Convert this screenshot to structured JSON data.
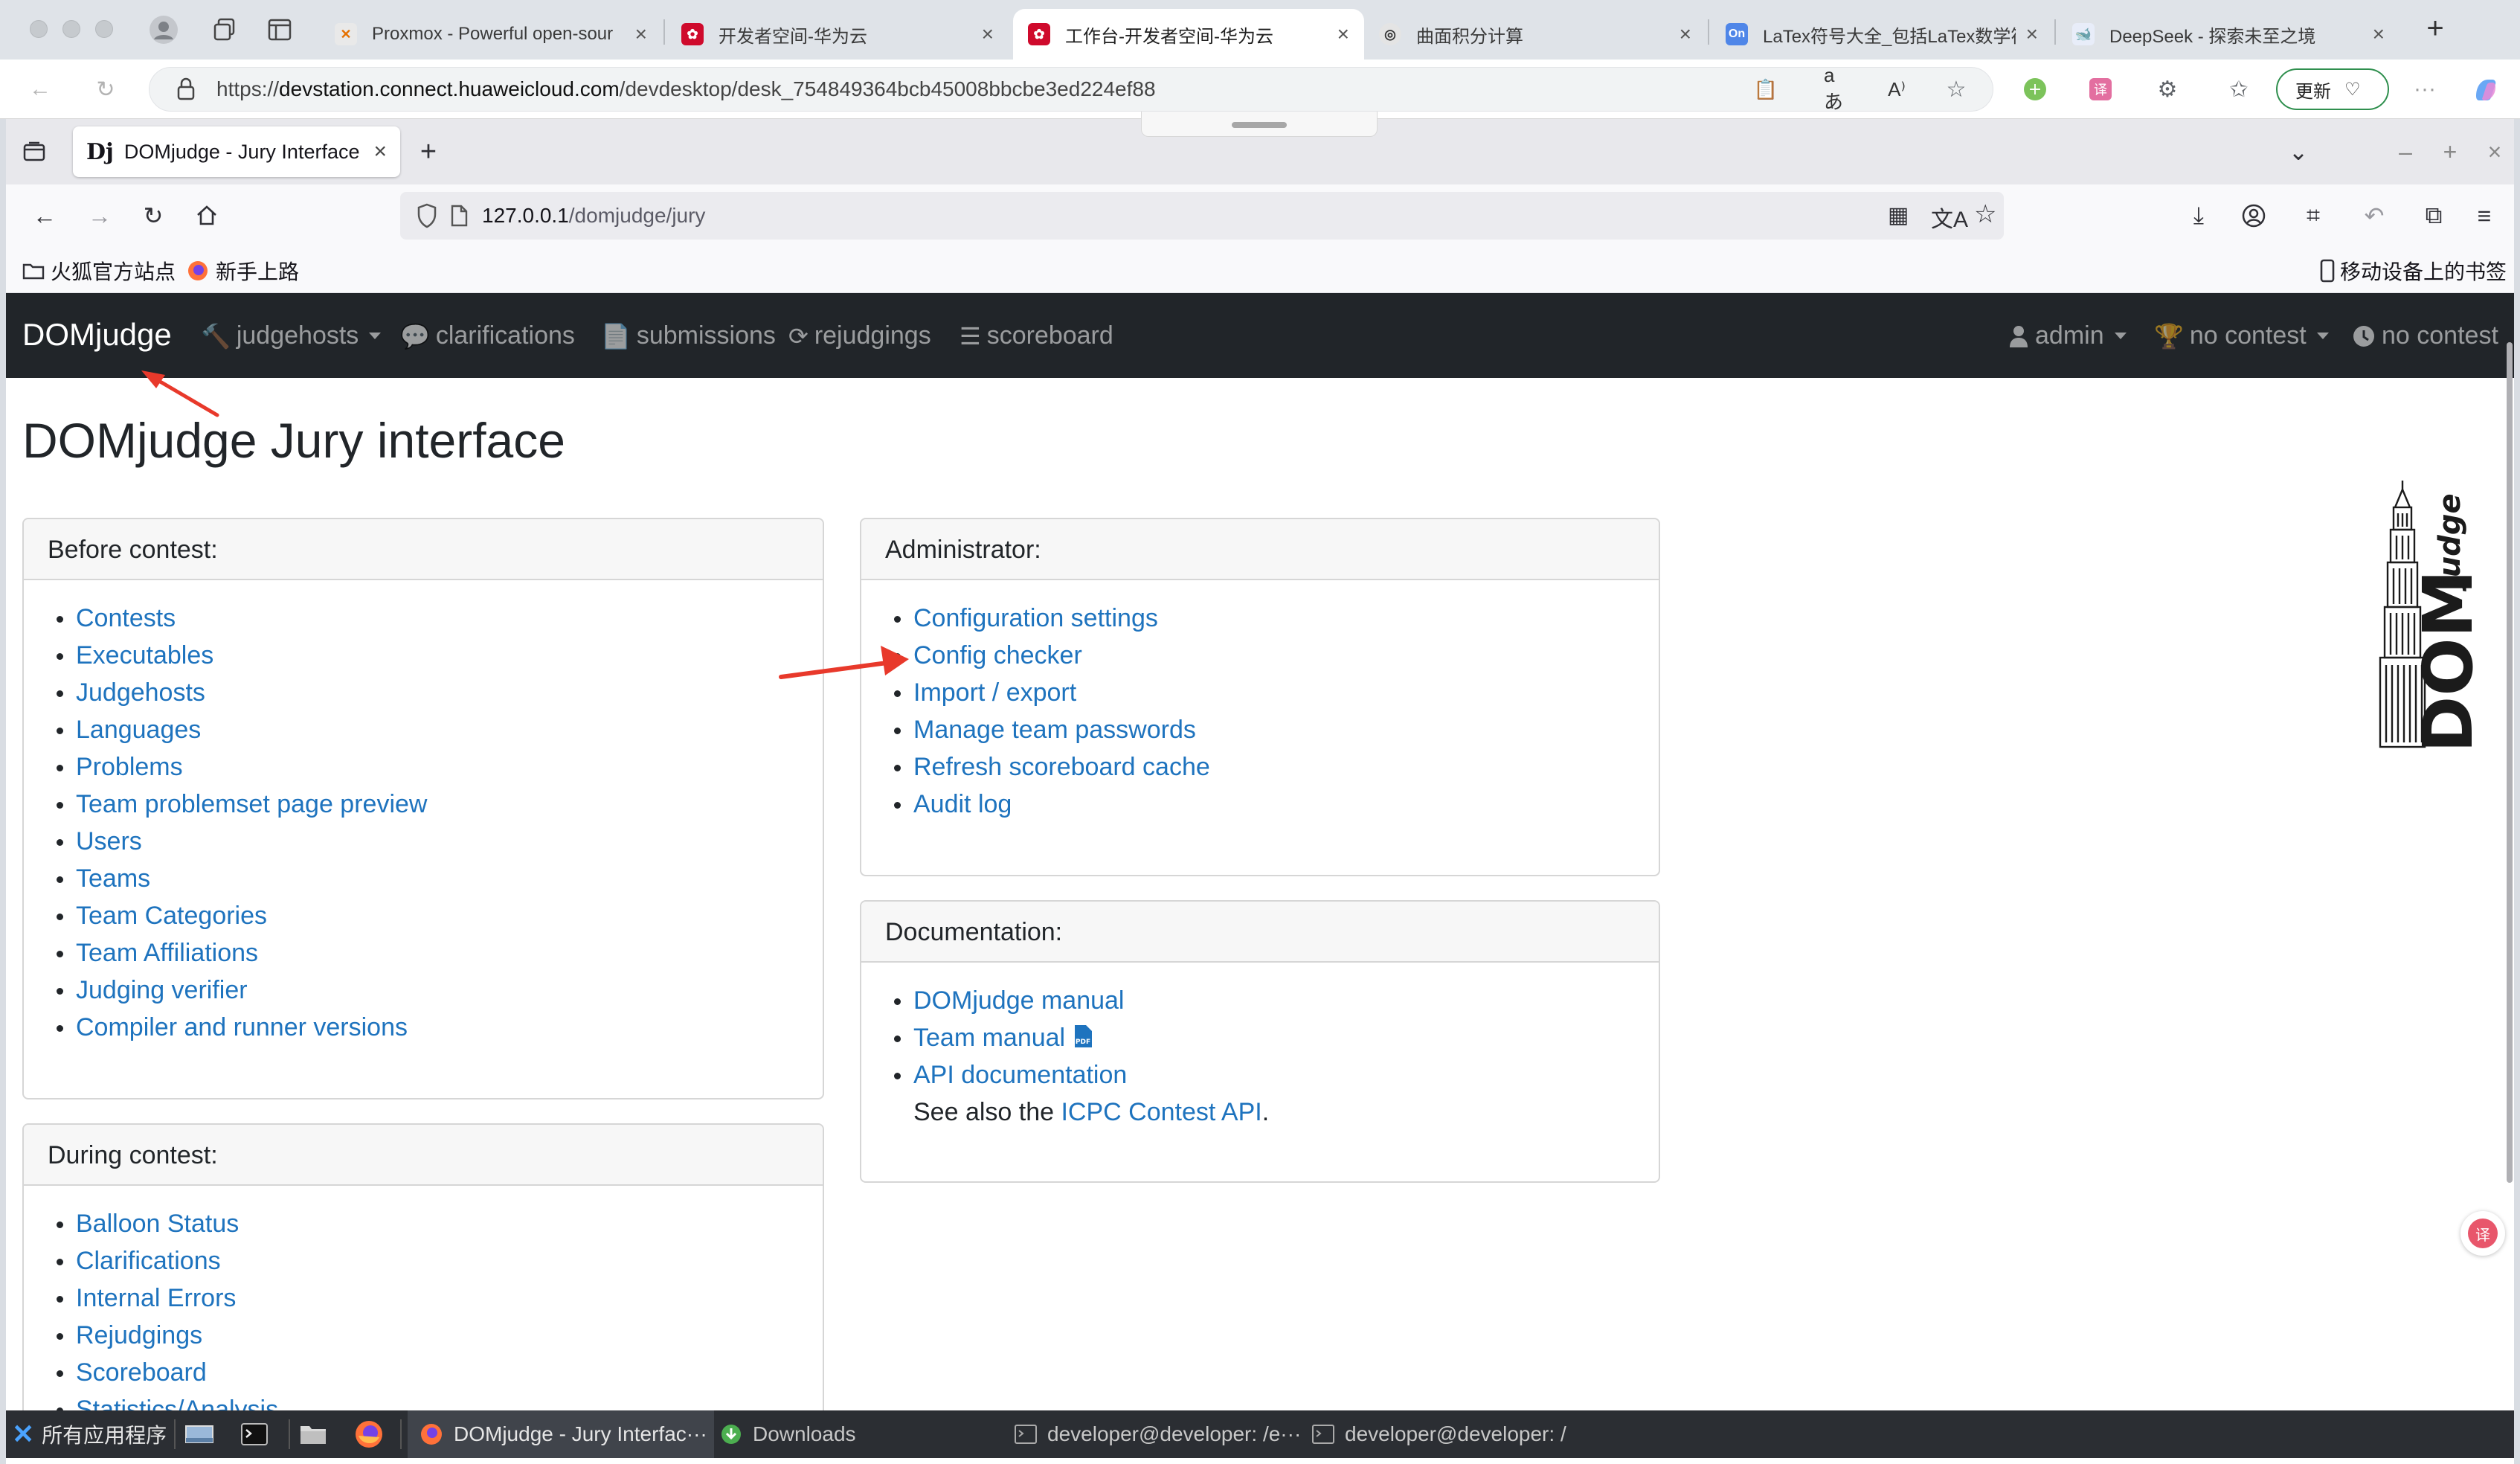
{
  "edge": {
    "tabs": [
      {
        "title": "Proxmox - Powerful open-sour",
        "icon": "proxmox-icon"
      },
      {
        "title": "开发者空间-华为云",
        "icon": "huawei-icon"
      },
      {
        "title": "工作台-开发者空间-华为云",
        "icon": "huawei-icon"
      },
      {
        "title": "曲面积分计算",
        "icon": "openai-icon"
      },
      {
        "title": "LaTex符号大全_包括LaTex数学符",
        "icon": "on-icon"
      },
      {
        "title": "DeepSeek - 探索未至之境",
        "icon": "deepseek-icon"
      }
    ],
    "active_tab": 2,
    "url_prefix": "https://",
    "url_host": "devstation.connect.huaweicloud.com",
    "url_path": "/devdesktop/desk_754849364bcb45008bbcbe3ed224ef88",
    "update_label": "更新"
  },
  "firefox": {
    "tab_title": "DOMjudge - Jury Interface",
    "url_host": "127.0.0.1",
    "url_path": "/domjudge/jury",
    "bookmarks": [
      "火狐官方站点",
      "新手上路"
    ],
    "mobile_bookmarks": "移动设备上的书签"
  },
  "navbar": {
    "brand": "DOMjudge",
    "items": [
      "judgehosts",
      "clarifications",
      "submissions",
      "rejudgings",
      "scoreboard"
    ],
    "right": {
      "user": "admin",
      "contest_select": "no contest",
      "contest_status": "no contest"
    }
  },
  "page": {
    "title": "DOMjudge Jury interface"
  },
  "before_contest": {
    "header": "Before contest:",
    "items": [
      "Contests",
      "Executables",
      "Judgehosts",
      "Languages",
      "Problems",
      "Team problemset page preview",
      "Users",
      "Teams",
      "Team Categories",
      "Team Affiliations",
      "Judging verifier",
      "Compiler and runner versions"
    ]
  },
  "during_contest": {
    "header": "During contest:",
    "items": [
      "Balloon Status",
      "Clarifications",
      "Internal Errors",
      "Rejudgings",
      "Scoreboard",
      "Statistics/Analysis"
    ]
  },
  "administrator": {
    "header": "Administrator:",
    "items": [
      "Configuration settings",
      "Config checker",
      "Import / export",
      "Manage team passwords",
      "Refresh scoreboard cache",
      "Audit log"
    ]
  },
  "documentation": {
    "header": "Documentation:",
    "items": [
      "DOMjudge manual",
      "Team manual",
      "API documentation"
    ],
    "see_also_prefix": "See also the ",
    "see_also_link": "ICPC Contest API",
    "see_also_suffix": "."
  },
  "logo": {
    "big": "DOM",
    "small": "judge"
  },
  "taskbar": {
    "apps_label": "所有应用程序",
    "windows": [
      "DOMjudge - Jury Interfac···",
      "Downloads",
      "developer@developer: /e···",
      "developer@developer: /"
    ]
  },
  "colors": {
    "navbar_bg": "#212529",
    "link": "#1e73be",
    "annotation_arrow": "#e8392b"
  }
}
